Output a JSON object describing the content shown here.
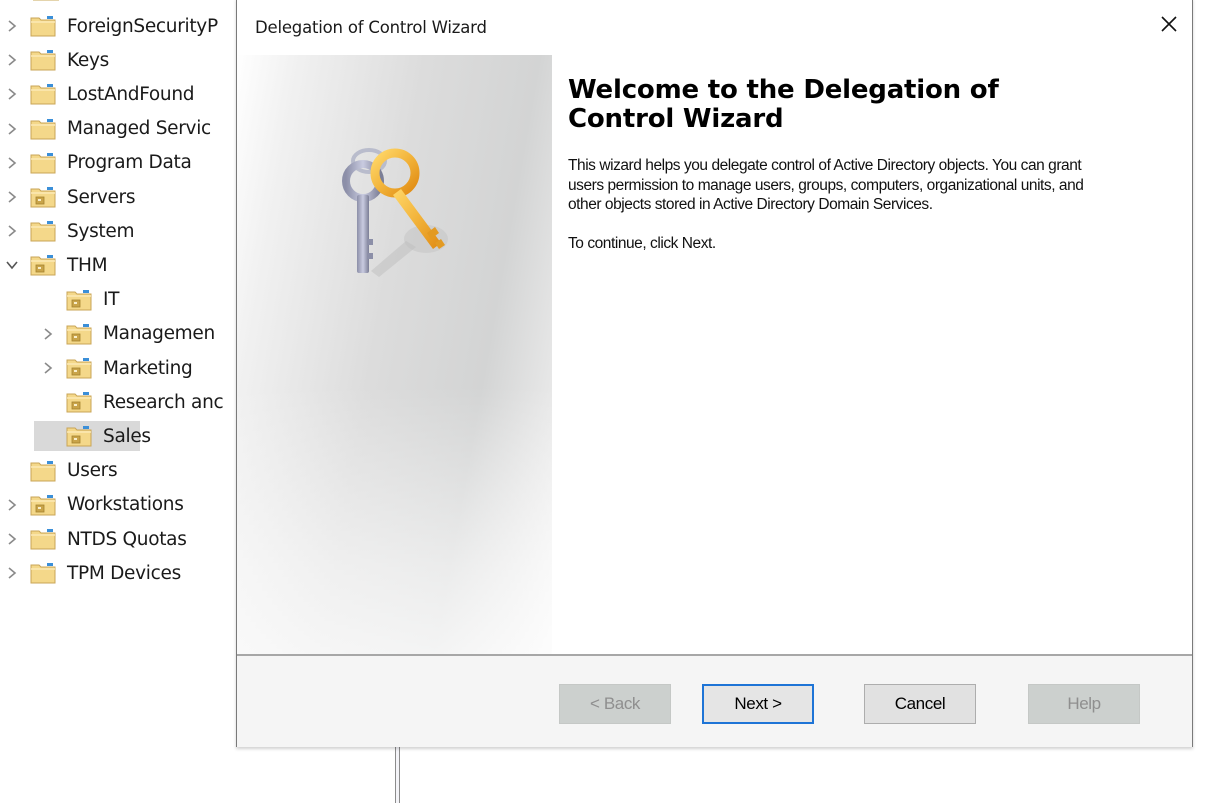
{
  "tree": {
    "items": [
      {
        "label": "ForeignSecurityPrincipals",
        "visible_label": "ForeignSecurityP",
        "level": 0,
        "expander": "collapsed",
        "icon": "folder-icon"
      },
      {
        "label": "Keys",
        "visible_label": "Keys",
        "level": 0,
        "expander": "collapsed",
        "icon": "folder-icon"
      },
      {
        "label": "LostAndFound",
        "visible_label": "LostAndFound",
        "level": 0,
        "expander": "collapsed",
        "icon": "folder-icon"
      },
      {
        "label": "Managed Service Accounts",
        "visible_label": "Managed Servic",
        "level": 0,
        "expander": "collapsed",
        "icon": "folder-icon"
      },
      {
        "label": "Program Data",
        "visible_label": "Program Data",
        "level": 0,
        "expander": "collapsed",
        "icon": "folder-icon"
      },
      {
        "label": "Servers",
        "visible_label": "Servers",
        "level": 0,
        "expander": "collapsed",
        "icon": "ou-folder-icon"
      },
      {
        "label": "System",
        "visible_label": "System",
        "level": 0,
        "expander": "collapsed",
        "icon": "folder-icon"
      },
      {
        "label": "THM",
        "visible_label": "THM",
        "level": 0,
        "expander": "expanded",
        "icon": "ou-folder-icon"
      },
      {
        "label": "IT",
        "visible_label": "IT",
        "level": 1,
        "expander": "none",
        "icon": "ou-folder-icon"
      },
      {
        "label": "Management",
        "visible_label": "Managemen",
        "level": 1,
        "expander": "collapsed",
        "icon": "ou-folder-icon"
      },
      {
        "label": "Marketing",
        "visible_label": "Marketing",
        "level": 1,
        "expander": "collapsed",
        "icon": "ou-folder-icon"
      },
      {
        "label": "Research and Development",
        "visible_label": "Research anc",
        "level": 1,
        "expander": "none",
        "icon": "ou-folder-icon"
      },
      {
        "label": "Sales",
        "visible_label": "Sales",
        "level": 1,
        "expander": "none",
        "icon": "ou-folder-icon",
        "selected": true
      },
      {
        "label": "Users",
        "visible_label": "Users",
        "level": 0,
        "expander": "none",
        "icon": "folder-icon"
      },
      {
        "label": "Workstations",
        "visible_label": "Workstations",
        "level": 0,
        "expander": "collapsed",
        "icon": "ou-folder-icon"
      },
      {
        "label": "NTDS Quotas",
        "visible_label": "NTDS Quotas",
        "level": 0,
        "expander": "collapsed",
        "icon": "folder-icon"
      },
      {
        "label": "TPM Devices",
        "visible_label": "TPM Devices",
        "level": 0,
        "expander": "collapsed",
        "icon": "folder-icon"
      }
    ]
  },
  "dialog": {
    "title": "Delegation of Control Wizard",
    "close_icon": "close-icon",
    "side_image_icon": "keys-icon",
    "heading": "Welcome to the Delegation of Control Wizard",
    "intro": "This wizard helps you delegate control of Active Directory objects. You can grant users permission to manage users, groups, computers, organizational units, and other objects stored in Active Directory Domain Services.",
    "continue_hint": "To continue, click Next.",
    "buttons": {
      "back": {
        "label": "< Back",
        "enabled": false
      },
      "next": {
        "label": "Next >",
        "enabled": true,
        "default": true
      },
      "cancel": {
        "label": "Cancel",
        "enabled": true
      },
      "help": {
        "label": "Help",
        "enabled": false
      }
    }
  },
  "colors": {
    "default_button_border": "#1e74d6",
    "selection_background": "#d9d9d9",
    "folder_yellow": "#f4d88a",
    "disabled_button": "#ccd0ce"
  }
}
